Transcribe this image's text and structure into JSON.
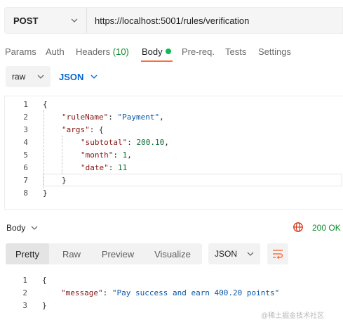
{
  "request": {
    "method": "POST",
    "url": "https://localhost:5001/rules/verification"
  },
  "tabs": {
    "params": "Params",
    "auth": "Auth",
    "headers": "Headers",
    "headers_count": "(10)",
    "body": "Body",
    "prereq": "Pre-req.",
    "tests": "Tests",
    "settings": "Settings"
  },
  "body_type": {
    "mode": "raw",
    "language": "JSON"
  },
  "editor": {
    "line_numbers": [
      "1",
      "2",
      "3",
      "4",
      "5",
      "6",
      "7",
      "8"
    ],
    "lines": [
      [
        {
          "t": "p",
          "v": "{"
        }
      ],
      [
        {
          "t": "k",
          "v": "\"ruleName\""
        },
        {
          "t": "p",
          "v": ": "
        },
        {
          "t": "s",
          "v": "\"Payment\""
        },
        {
          "t": "p",
          "v": ","
        }
      ],
      [
        {
          "t": "k",
          "v": "\"args\""
        },
        {
          "t": "p",
          "v": ": {"
        }
      ],
      [
        {
          "t": "k",
          "v": "\"subtotal\""
        },
        {
          "t": "p",
          "v": ": "
        },
        {
          "t": "n",
          "v": "200.10"
        },
        {
          "t": "p",
          "v": ","
        }
      ],
      [
        {
          "t": "k",
          "v": "\"month\""
        },
        {
          "t": "p",
          "v": ": "
        },
        {
          "t": "n",
          "v": "1"
        },
        {
          "t": "p",
          "v": ","
        }
      ],
      [
        {
          "t": "k",
          "v": "\"date\""
        },
        {
          "t": "p",
          "v": ": "
        },
        {
          "t": "n",
          "v": "11"
        }
      ],
      [
        {
          "t": "p",
          "v": "}"
        }
      ],
      [
        {
          "t": "p",
          "v": "}"
        }
      ]
    ]
  },
  "response": {
    "body_label": "Body",
    "status": "200 OK",
    "view_tabs": [
      "Pretty",
      "Raw",
      "Preview",
      "Visualize"
    ],
    "format": "JSON",
    "line_numbers": [
      "1",
      "2",
      "3"
    ],
    "lines": [
      [
        {
          "t": "p",
          "v": "{"
        }
      ],
      [
        {
          "t": "k",
          "v": "\"message\""
        },
        {
          "t": "p",
          "v": ": "
        },
        {
          "t": "s",
          "v": "\"Pay success and earn 400.20 points\""
        }
      ],
      [
        {
          "t": "p",
          "v": "}"
        }
      ]
    ]
  },
  "watermark": "@稀土掘金技术社区",
  "colors": {
    "accent": "#ff6c37",
    "status_ok": "#0a8a2a",
    "link_blue": "#0265d2",
    "json_key": "#8a1616",
    "json_string": "#0a58a8",
    "json_number": "#0d6b35"
  }
}
